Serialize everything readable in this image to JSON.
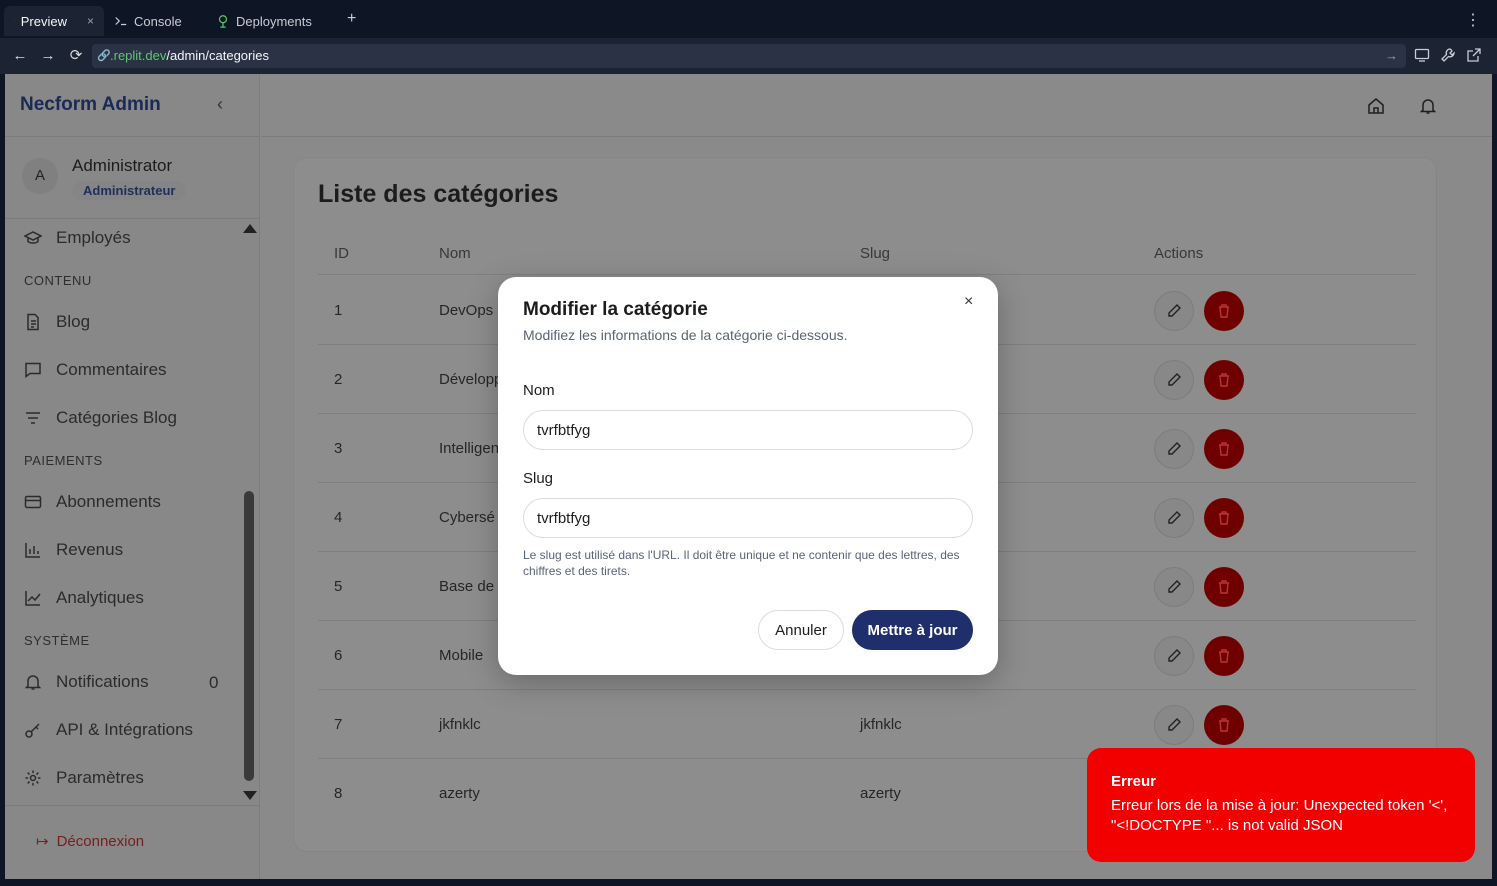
{
  "browser": {
    "tabs": [
      {
        "label": "Preview",
        "icon": "monitor-icon",
        "active": true
      },
      {
        "label": "Console",
        "icon": "terminal-icon",
        "active": false
      },
      {
        "label": "Deployments",
        "icon": "deploy-icon",
        "active": false
      }
    ],
    "close_glyph": "×",
    "add_glyph": "+",
    "url_domain": ".replit.dev",
    "url_path": "/admin/categories"
  },
  "sidebar": {
    "brand": "Necform Admin",
    "user": {
      "initial": "A",
      "name": "Administrator",
      "role": "Administrateur"
    },
    "items": [
      {
        "label": "Employés",
        "icon": "graduation-cap-icon"
      },
      {
        "label": "Blog",
        "icon": "document-icon"
      },
      {
        "label": "Commentaires",
        "icon": "comment-icon"
      },
      {
        "label": "Catégories Blog",
        "icon": "filter-icon"
      },
      {
        "label": "Abonnements",
        "icon": "card-icon"
      },
      {
        "label": "Revenus",
        "icon": "bar-chart-icon"
      },
      {
        "label": "Analytiques",
        "icon": "line-chart-icon"
      },
      {
        "label": "Notifications",
        "icon": "bell-icon",
        "count": "0"
      },
      {
        "label": "API & Intégrations",
        "icon": "key-icon"
      },
      {
        "label": "Paramètres",
        "icon": "gear-icon"
      }
    ],
    "sections": [
      "CONTENU",
      "PAIEMENTS",
      "SYSTÈME"
    ],
    "logout": "Déconnexion"
  },
  "main": {
    "title": "Liste des catégories",
    "columns": [
      "ID",
      "Nom",
      "Slug",
      "Actions"
    ],
    "rows": [
      {
        "id": "1",
        "name": "DevOps",
        "slug": ""
      },
      {
        "id": "2",
        "name": "Développ",
        "slug": ""
      },
      {
        "id": "3",
        "name": "Intelligen",
        "slug": ""
      },
      {
        "id": "4",
        "name": "Cybersé",
        "slug": ""
      },
      {
        "id": "5",
        "name": "Base de",
        "slug": ""
      },
      {
        "id": "6",
        "name": "Mobile",
        "slug": ""
      },
      {
        "id": "7",
        "name": "jkfnklc",
        "slug": "jkfnklc"
      },
      {
        "id": "8",
        "name": "azerty",
        "slug": "azerty"
      }
    ]
  },
  "modal": {
    "title": "Modifier la catégorie",
    "subtitle": "Modifiez les informations de la catégorie ci-dessous.",
    "close_glyph": "×",
    "name_label": "Nom",
    "name_value": "tvrfbtfyg",
    "slug_label": "Slug",
    "slug_value": "tvrfbtfyg",
    "slug_help": "Le slug est utilisé dans l'URL. Il doit être unique et ne contenir que des lettres, des chiffres et des tirets.",
    "cancel": "Annuler",
    "submit": "Mettre à jour"
  },
  "toast": {
    "title": "Erreur",
    "message": "Erreur lors de la mise à jour: Unexpected token '<', \"<!DOCTYPE \"... is not valid JSON",
    "color": "#f20000"
  }
}
